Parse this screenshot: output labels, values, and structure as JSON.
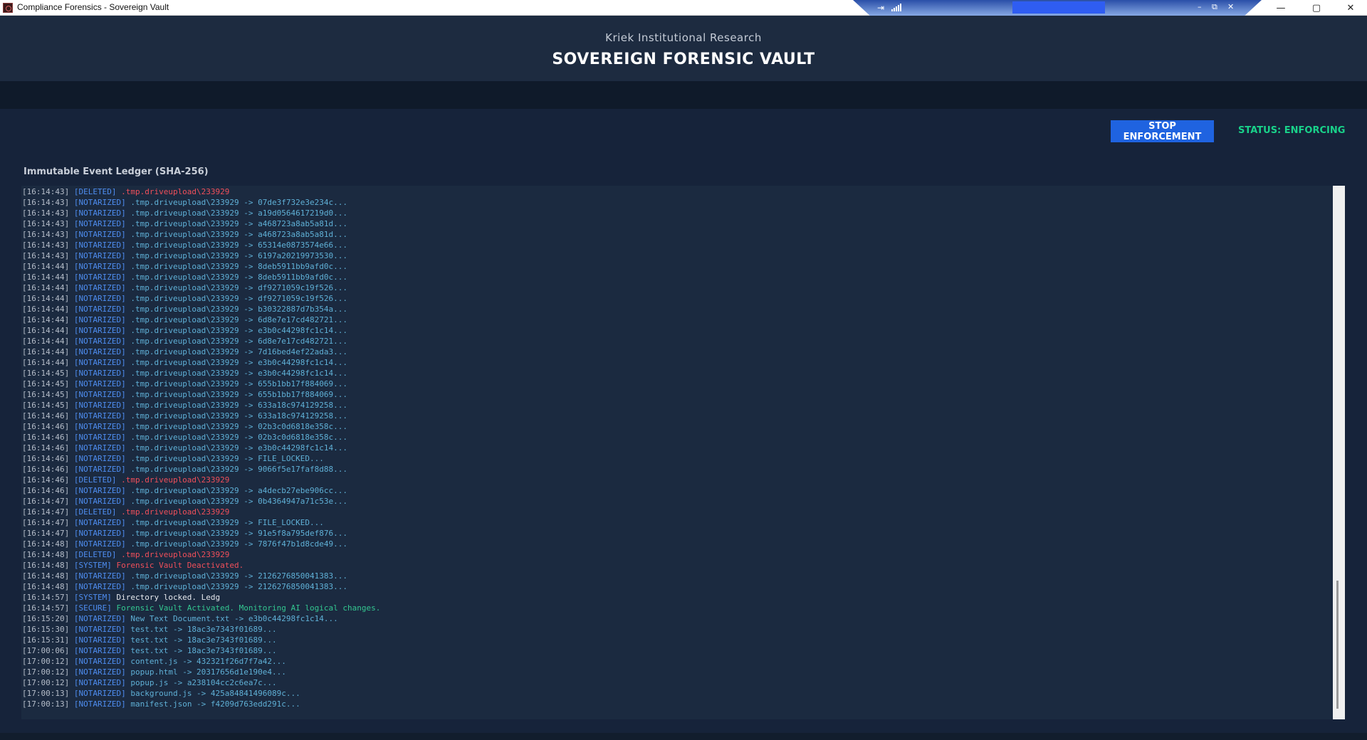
{
  "window": {
    "title": "Compliance Forensics - Sovereign Vault",
    "min_glyph": "—",
    "max_glyph": "▢",
    "close_glyph": "✕"
  },
  "rdp_bar": {
    "pin_icon": "pin-icon",
    "signal_icon": "signal-bars-icon",
    "min_glyph": "–",
    "restore_glyph": "⧉",
    "close_glyph": "✕",
    "accent": "#2f5df2"
  },
  "header": {
    "org_name": "Kriek Institutional Research",
    "title": "SOVEREIGN FORENSIC VAULT"
  },
  "controls": {
    "stop_label": "STOP ENFORCEMENT",
    "status_text": "STATUS: ENFORCING",
    "status_color": "#19d28a",
    "button_color": "#1f63e0"
  },
  "ledger": {
    "label": "Immutable Event Ledger (SHA-256)",
    "entries": [
      {
        "ts": "[16:14:43]",
        "tag": "[DELETED]",
        "msg": ".tmp.driveupload\\233929",
        "kind": "deleted"
      },
      {
        "ts": "[16:14:43]",
        "tag": "[NOTARIZED]",
        "msg": ".tmp.driveupload\\233929 -> 07de3f732e3e234c...",
        "kind": "notarized"
      },
      {
        "ts": "[16:14:43]",
        "tag": "[NOTARIZED]",
        "msg": ".tmp.driveupload\\233929 -> a19d0564617219d0...",
        "kind": "notarized"
      },
      {
        "ts": "[16:14:43]",
        "tag": "[NOTARIZED]",
        "msg": ".tmp.driveupload\\233929 -> a468723a8ab5a81d...",
        "kind": "notarized"
      },
      {
        "ts": "[16:14:43]",
        "tag": "[NOTARIZED]",
        "msg": ".tmp.driveupload\\233929 -> a468723a8ab5a81d...",
        "kind": "notarized"
      },
      {
        "ts": "[16:14:43]",
        "tag": "[NOTARIZED]",
        "msg": ".tmp.driveupload\\233929 -> 65314e0873574e66...",
        "kind": "notarized"
      },
      {
        "ts": "[16:14:43]",
        "tag": "[NOTARIZED]",
        "msg": ".tmp.driveupload\\233929 -> 6197a20219973530...",
        "kind": "notarized"
      },
      {
        "ts": "[16:14:44]",
        "tag": "[NOTARIZED]",
        "msg": ".tmp.driveupload\\233929 -> 8deb5911bb9afd0c...",
        "kind": "notarized"
      },
      {
        "ts": "[16:14:44]",
        "tag": "[NOTARIZED]",
        "msg": ".tmp.driveupload\\233929 -> 8deb5911bb9afd0c...",
        "kind": "notarized"
      },
      {
        "ts": "[16:14:44]",
        "tag": "[NOTARIZED]",
        "msg": ".tmp.driveupload\\233929 -> df9271059c19f526...",
        "kind": "notarized"
      },
      {
        "ts": "[16:14:44]",
        "tag": "[NOTARIZED]",
        "msg": ".tmp.driveupload\\233929 -> df9271059c19f526...",
        "kind": "notarized"
      },
      {
        "ts": "[16:14:44]",
        "tag": "[NOTARIZED]",
        "msg": ".tmp.driveupload\\233929 -> b30322887d7b354a...",
        "kind": "notarized"
      },
      {
        "ts": "[16:14:44]",
        "tag": "[NOTARIZED]",
        "msg": ".tmp.driveupload\\233929 -> 6d8e7e17cd482721...",
        "kind": "notarized"
      },
      {
        "ts": "[16:14:44]",
        "tag": "[NOTARIZED]",
        "msg": ".tmp.driveupload\\233929 -> e3b0c44298fc1c14...",
        "kind": "notarized"
      },
      {
        "ts": "[16:14:44]",
        "tag": "[NOTARIZED]",
        "msg": ".tmp.driveupload\\233929 -> 6d8e7e17cd482721...",
        "kind": "notarized"
      },
      {
        "ts": "[16:14:44]",
        "tag": "[NOTARIZED]",
        "msg": ".tmp.driveupload\\233929 -> 7d16bed4ef22ada3...",
        "kind": "notarized"
      },
      {
        "ts": "[16:14:44]",
        "tag": "[NOTARIZED]",
        "msg": ".tmp.driveupload\\233929 -> e3b0c44298fc1c14...",
        "kind": "notarized"
      },
      {
        "ts": "[16:14:45]",
        "tag": "[NOTARIZED]",
        "msg": ".tmp.driveupload\\233929 -> e3b0c44298fc1c14...",
        "kind": "notarized"
      },
      {
        "ts": "[16:14:45]",
        "tag": "[NOTARIZED]",
        "msg": ".tmp.driveupload\\233929 -> 655b1bb17f884069...",
        "kind": "notarized"
      },
      {
        "ts": "[16:14:45]",
        "tag": "[NOTARIZED]",
        "msg": ".tmp.driveupload\\233929 -> 655b1bb17f884069...",
        "kind": "notarized"
      },
      {
        "ts": "[16:14:45]",
        "tag": "[NOTARIZED]",
        "msg": ".tmp.driveupload\\233929 -> 633a18c974129258...",
        "kind": "notarized"
      },
      {
        "ts": "[16:14:46]",
        "tag": "[NOTARIZED]",
        "msg": ".tmp.driveupload\\233929 -> 633a18c974129258...",
        "kind": "notarized"
      },
      {
        "ts": "[16:14:46]",
        "tag": "[NOTARIZED]",
        "msg": ".tmp.driveupload\\233929 -> 02b3c0d6818e358c...",
        "kind": "notarized"
      },
      {
        "ts": "[16:14:46]",
        "tag": "[NOTARIZED]",
        "msg": ".tmp.driveupload\\233929 -> 02b3c0d6818e358c...",
        "kind": "notarized"
      },
      {
        "ts": "[16:14:46]",
        "tag": "[NOTARIZED]",
        "msg": ".tmp.driveupload\\233929 -> e3b0c44298fc1c14...",
        "kind": "notarized"
      },
      {
        "ts": "[16:14:46]",
        "tag": "[NOTARIZED]",
        "msg": ".tmp.driveupload\\233929 -> FILE_LOCKED...",
        "kind": "notarized"
      },
      {
        "ts": "[16:14:46]",
        "tag": "[NOTARIZED]",
        "msg": ".tmp.driveupload\\233929 -> 9066f5e17faf8d88...",
        "kind": "notarized"
      },
      {
        "ts": "[16:14:46]",
        "tag": "[DELETED]",
        "msg": ".tmp.driveupload\\233929",
        "kind": "deleted"
      },
      {
        "ts": "[16:14:46]",
        "tag": "[NOTARIZED]",
        "msg": ".tmp.driveupload\\233929 -> a4decb27ebe906cc...",
        "kind": "notarized"
      },
      {
        "ts": "[16:14:47]",
        "tag": "[NOTARIZED]",
        "msg": ".tmp.driveupload\\233929 -> 0b4364947a71c53e...",
        "kind": "notarized"
      },
      {
        "ts": "[16:14:47]",
        "tag": "[DELETED]",
        "msg": ".tmp.driveupload\\233929",
        "kind": "deleted"
      },
      {
        "ts": "[16:14:47]",
        "tag": "[NOTARIZED]",
        "msg": ".tmp.driveupload\\233929 -> FILE_LOCKED...",
        "kind": "notarized"
      },
      {
        "ts": "[16:14:47]",
        "tag": "[NOTARIZED]",
        "msg": ".tmp.driveupload\\233929 -> 91e5f8a795def876...",
        "kind": "notarized"
      },
      {
        "ts": "[16:14:48]",
        "tag": "[NOTARIZED]",
        "msg": ".tmp.driveupload\\233929 -> 7876f47b1d8cde49...",
        "kind": "notarized"
      },
      {
        "ts": "[16:14:48]",
        "tag": "[DELETED]",
        "msg": ".tmp.driveupload\\233929",
        "kind": "deleted"
      },
      {
        "ts": "[16:14:48]",
        "tag": "[SYSTEM]",
        "msg": "Forensic Vault Deactivated.",
        "kind": "system-red"
      },
      {
        "ts": "[16:14:48]",
        "tag": "[NOTARIZED]",
        "msg": ".tmp.driveupload\\233929 -> 2126276850041383...",
        "kind": "notarized"
      },
      {
        "ts": "[16:14:48]",
        "tag": "[NOTARIZED]",
        "msg": ".tmp.driveupload\\233929 -> 2126276850041383...",
        "kind": "notarized"
      },
      {
        "ts": "[16:14:57]",
        "tag": "[SYSTEM]",
        "msg": "Directory locked. Ledg",
        "kind": "system-white"
      },
      {
        "ts": "[16:14:57]",
        "tag": "[SECURE]",
        "msg": "Forensic Vault Activated. Monitoring AI logical changes.",
        "kind": "secure"
      },
      {
        "ts": "[16:15:20]",
        "tag": "[NOTARIZED]",
        "msg": "New Text Document.txt -> e3b0c44298fc1c14...",
        "kind": "notarized"
      },
      {
        "ts": "[16:15:30]",
        "tag": "[NOTARIZED]",
        "msg": "test.txt -> 18ac3e7343f01689...",
        "kind": "notarized"
      },
      {
        "ts": "[16:15:31]",
        "tag": "[NOTARIZED]",
        "msg": "test.txt -> 18ac3e7343f01689...",
        "kind": "notarized"
      },
      {
        "ts": "[17:00:06]",
        "tag": "[NOTARIZED]",
        "msg": "test.txt -> 18ac3e7343f01689...",
        "kind": "notarized"
      },
      {
        "ts": "[17:00:12]",
        "tag": "[NOTARIZED]",
        "msg": "content.js -> 432321f26d7f7a42...",
        "kind": "notarized"
      },
      {
        "ts": "[17:00:12]",
        "tag": "[NOTARIZED]",
        "msg": "popup.html -> 20317656d1e190e4...",
        "kind": "notarized"
      },
      {
        "ts": "[17:00:12]",
        "tag": "[NOTARIZED]",
        "msg": "popup.js -> a238104cc2c6ea7c...",
        "kind": "notarized"
      },
      {
        "ts": "[17:00:13]",
        "tag": "[NOTARIZED]",
        "msg": "background.js -> 425a84841496089c...",
        "kind": "notarized"
      },
      {
        "ts": "[17:00:13]",
        "tag": "[NOTARIZED]",
        "msg": "manifest.json -> f4209d763edd291c...",
        "kind": "notarized"
      }
    ]
  }
}
